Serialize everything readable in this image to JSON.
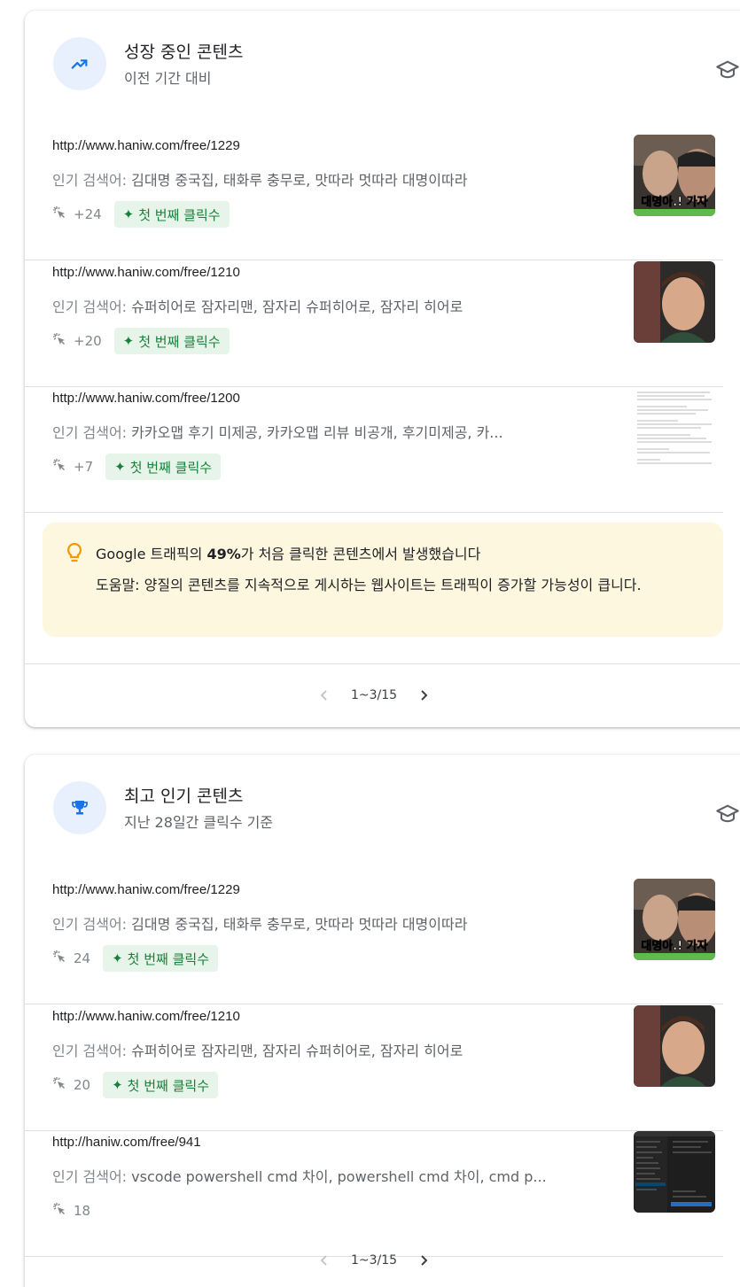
{
  "cards": [
    {
      "title": "성장 중인 콘텐츠",
      "subtitle": "이전 기간 대비",
      "header_icon": "trending-up-icon",
      "rows": [
        {
          "url": "http://www.haniw.com/free/1229",
          "queries_label": "인기 검색어:",
          "queries": "김대명 중국집, 태화루 충무로, 맛따라 멋따라 대명이따라",
          "clicks": "+24",
          "badge": "첫 번째 클릭수",
          "thumb_caption": "대명아.! 가자"
        },
        {
          "url": "http://www.haniw.com/free/1210",
          "queries_label": "인기 검색어:",
          "queries": "슈퍼히어로 잠자리맨, 잠자리 슈퍼히어로, 잠자리 히어로",
          "clicks": "+20",
          "badge": "첫 번째 클릭수"
        },
        {
          "url": "http://www.haniw.com/free/1200",
          "queries_label": "인기 검색어:",
          "queries": "카카오맵 후기 미제공, 카카오맵 리뷰 비공개, 후기미제공, 카...",
          "clicks": "+7",
          "badge": "첫 번째 클릭수"
        }
      ],
      "tip": {
        "pre": "Google 트래픽의 ",
        "bold": "49%",
        "post": "가 처음 클릭한 콘텐츠에서 발생했습니다",
        "body": "도움말: 양질의 콘텐츠를 지속적으로 게시하는 웹사이트는 트래픽이 증가할 가능성이 큽니다."
      },
      "pagination": "1~3/15"
    },
    {
      "title": "최고 인기 콘텐츠",
      "subtitle": "지난 28일간 클릭수 기준",
      "header_icon": "trophy-icon",
      "rows": [
        {
          "url": "http://www.haniw.com/free/1229",
          "queries_label": "인기 검색어:",
          "queries": "김대명 중국집, 태화루 충무로, 맛따라 멋따라 대명이따라",
          "clicks": "24",
          "badge": "첫 번째 클릭수",
          "thumb_caption": "대명아.! 가자"
        },
        {
          "url": "http://www.haniw.com/free/1210",
          "queries_label": "인기 검색어:",
          "queries": "슈퍼히어로 잠자리맨, 잠자리 슈퍼히어로, 잠자리 히어로",
          "clicks": "20",
          "badge": "첫 번째 클릭수"
        },
        {
          "url": "http://haniw.com/free/941",
          "queries_label": "인기 검색어:",
          "queries": "vscode powershell cmd 차이, powershell cmd 차이, cmd p...",
          "clicks": "18"
        }
      ],
      "pagination": "1~3/15"
    }
  ],
  "colors": {
    "accent": "#1a73e8",
    "badge_bg": "#e6f4ea",
    "badge_text": "#188038",
    "tip_bg": "#fef7e0",
    "tip_icon": "#f29900"
  }
}
